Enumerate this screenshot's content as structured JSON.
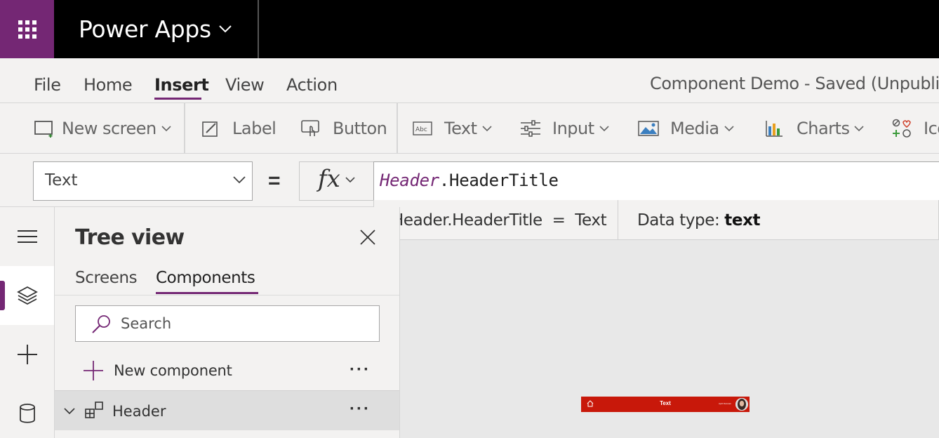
{
  "app": {
    "name": "Power Apps"
  },
  "menu": {
    "items": [
      {
        "label": "File"
      },
      {
        "label": "Home"
      },
      {
        "label": "Insert"
      },
      {
        "label": "View"
      },
      {
        "label": "Action"
      }
    ],
    "active": "Insert",
    "doc_status": "Component Demo - Saved (Unpublish"
  },
  "ribbon": {
    "new_screen": "New screen",
    "label": "Label",
    "button": "Button",
    "text": "Text",
    "input": "Input",
    "media": "Media",
    "charts": "Charts",
    "icons": "Ico"
  },
  "formula": {
    "property": "Text",
    "equals": "=",
    "fx": "fx",
    "object": "Header",
    "member": ".HeaderTitle",
    "hint_expr": "Header.HeaderTitle  =  Text",
    "hint_type_label": "Data type: ",
    "hint_type_value": "text"
  },
  "tree": {
    "title": "Tree view",
    "tabs": [
      "Screens",
      "Components"
    ],
    "active_tab": "Components",
    "search_placeholder": "Search",
    "new_component": "New component",
    "items": [
      {
        "label": "Header",
        "expanded": true
      }
    ]
  },
  "canvas": {
    "header_title": "Text",
    "header_user": "April Dunnam",
    "header_color": "#c8180a"
  },
  "colors": {
    "accent": "#742774",
    "titlebar": "#000000"
  }
}
